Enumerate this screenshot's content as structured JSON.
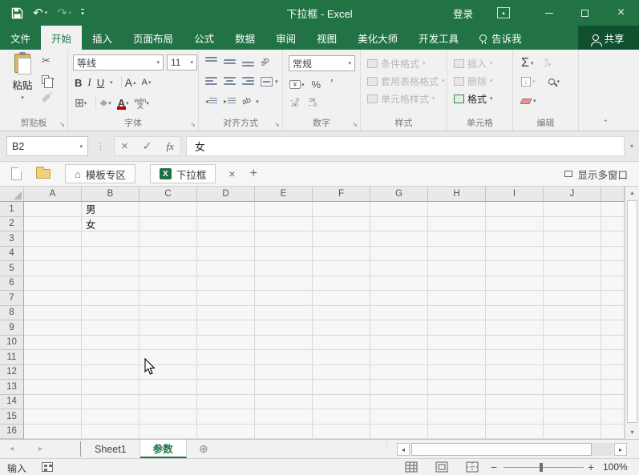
{
  "titlebar": {
    "title": "下拉框 - Excel",
    "sign_in": "登录"
  },
  "icons": {
    "undo": "↶",
    "redo": "↷",
    "dropdown": "▾",
    "scissors": "✂",
    "cancel": "×",
    "check": "✓",
    "fx": "fx",
    "dots": "⋮",
    "home": "⌂",
    "excel_logo": "X",
    "close_tab": "×",
    "new_tab": "+",
    "up": "▴",
    "down": "▾",
    "left": "◂",
    "right": "▸",
    "new_sheet": "⊕",
    "sigma": "Σ",
    "grip": "⋮⋮",
    "launcher": "⇘",
    "collapse": "⌃",
    "minimize": "–",
    "close_window": "×",
    "bold": "B",
    "italic": "I",
    "underline": "U",
    "borders": "⊞",
    "grow_font": "A",
    "shrink_font": "A",
    "font_color": "A",
    "wen": "wén\n文",
    "percent": "%",
    "comma": "ʼ",
    "currency": "¥",
    "inc_decimal": "←.0\n.00",
    "dec_decimal": ".00\n→.0",
    "orientation": "ab",
    "sort": "A\nZ▾",
    "fill": "↓",
    "money_dd": "▾",
    "minus": "−",
    "plus": "+"
  },
  "ribbon_tabs": [
    {
      "id": "file",
      "label": "文件",
      "active": false
    },
    {
      "id": "home",
      "label": "开始",
      "active": true
    },
    {
      "id": "insert",
      "label": "插入",
      "active": false
    },
    {
      "id": "page-layout",
      "label": "页面布局",
      "active": false
    },
    {
      "id": "formulas",
      "label": "公式",
      "active": false
    },
    {
      "id": "data",
      "label": "数据",
      "active": false
    },
    {
      "id": "review",
      "label": "审阅",
      "active": false
    },
    {
      "id": "view",
      "label": "视图",
      "active": false
    },
    {
      "id": "beautify-master",
      "label": "美化大师",
      "active": false
    },
    {
      "id": "developer",
      "label": "开发工具",
      "active": false
    },
    {
      "id": "tell-me",
      "label": "告诉我",
      "active": false,
      "icon": "lightbulb"
    }
  ],
  "share": {
    "label": "共享"
  },
  "ribbon": {
    "paste_label": "粘贴",
    "font_name": "等线",
    "font_size": "11",
    "number_format": "常规",
    "group_labels": {
      "clipboard": "剪贴板",
      "font": "字体",
      "alignment": "对齐方式",
      "number": "数字",
      "styles": "样式",
      "cells": "单元格",
      "editing": "编辑"
    },
    "style_buttons": [
      "条件格式",
      "套用表格格式",
      "单元格样式"
    ],
    "cell_buttons": [
      "插入",
      "删除",
      "格式"
    ]
  },
  "formula_bar": {
    "name_box": "B2",
    "content": "女"
  },
  "doc_tab_bar": {
    "tabs": [
      {
        "label": "模板专区",
        "icon": "home",
        "active": false
      },
      {
        "label": "下拉框",
        "icon": "excel",
        "active": true
      }
    ],
    "show_windows_label": "显示多窗口"
  },
  "grid": {
    "columns": [
      "A",
      "B",
      "C",
      "D",
      "E",
      "F",
      "G",
      "H",
      "I",
      "J"
    ],
    "row_count": 16,
    "cells": [
      {
        "ref": "B1",
        "col": "B",
        "row": 1,
        "value": "男"
      },
      {
        "ref": "B2",
        "col": "B",
        "row": 2,
        "value": "女"
      }
    ]
  },
  "sheet_bar": {
    "sheets": [
      {
        "label": "Sheet1",
        "active": false
      },
      {
        "label": "参数",
        "active": true
      }
    ]
  },
  "status_bar": {
    "mode": "输入",
    "zoom_level": "100%"
  },
  "colors": {
    "accent_green": "#217346",
    "font_color_red": "#c00000",
    "share_bg": "#10502f"
  }
}
